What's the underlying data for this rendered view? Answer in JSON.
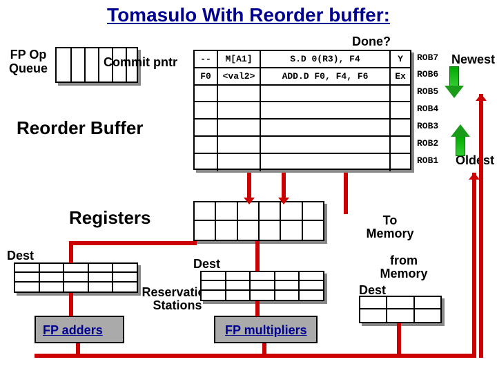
{
  "title": "Tomasulo With Reorder buffer:",
  "labels": {
    "done": "Done?",
    "fp_op_queue": "FP Op\nQueue",
    "commit_pntr": "Commit pntr",
    "reorder_buffer": "Reorder Buffer",
    "registers": "Registers",
    "newest": "Newest",
    "oldest": "Oldest",
    "dest": "Dest",
    "reservation_stations": "Reservation\nStations",
    "fp_adders": "FP adders",
    "fp_multipliers": "FP multipliers",
    "to_memory": "To\nMemory",
    "from_memory": "from\nMemory"
  },
  "rob_rows": [
    {
      "tag": "ROB7",
      "dest": "--",
      "val": "M[A1]",
      "instr": "S.D 0(R3), F4",
      "done": "Y"
    },
    {
      "tag": "ROB6",
      "dest": "F0",
      "val": "<val2>",
      "instr": "ADD.D F0, F4, F6",
      "done": "Ex"
    },
    {
      "tag": "ROB5",
      "dest": "",
      "val": "",
      "instr": "",
      "done": ""
    },
    {
      "tag": "ROB4",
      "dest": "",
      "val": "",
      "instr": "",
      "done": ""
    },
    {
      "tag": "ROB3",
      "dest": "",
      "val": "",
      "instr": "",
      "done": ""
    },
    {
      "tag": "ROB2",
      "dest": "",
      "val": "",
      "instr": "",
      "done": ""
    },
    {
      "tag": "ROB1",
      "dest": "",
      "val": "",
      "instr": "",
      "done": ""
    }
  ],
  "colors": {
    "title": "#000090",
    "bus": "#c00",
    "arrow": "#1a9c1a"
  }
}
